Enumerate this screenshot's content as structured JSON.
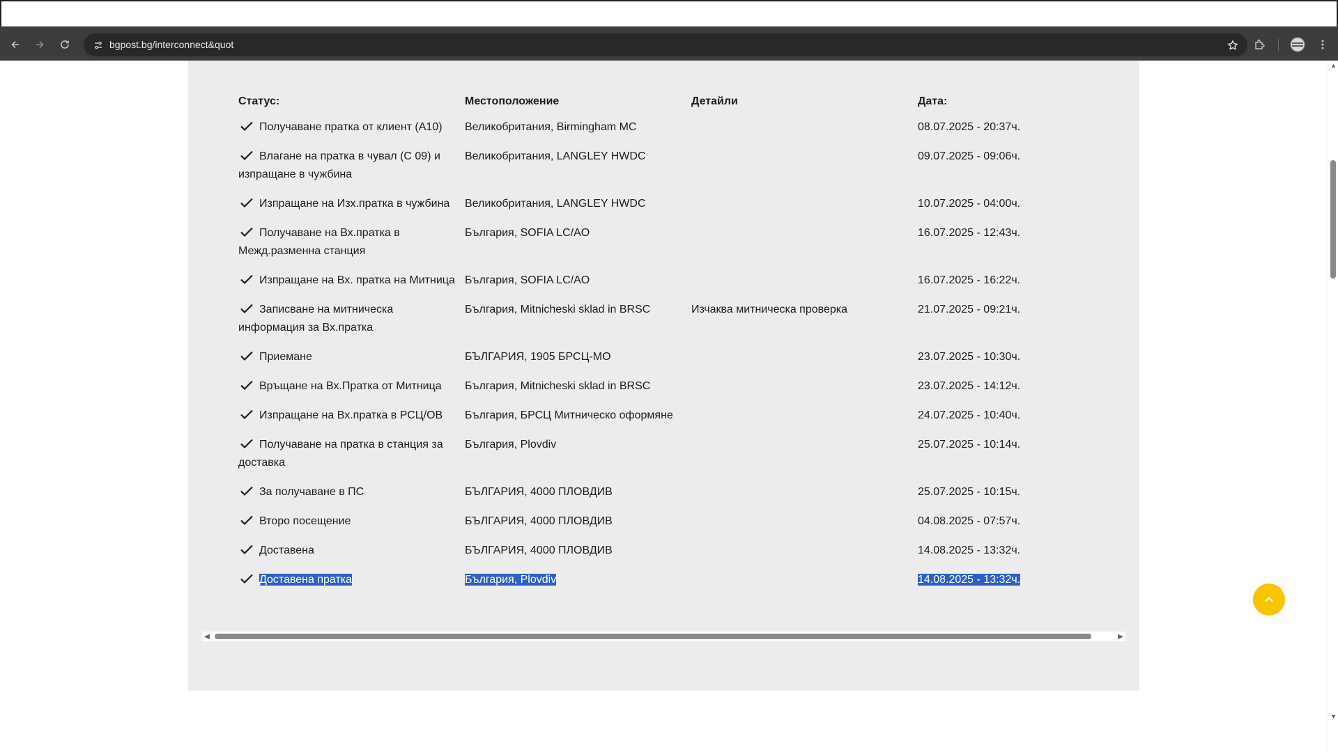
{
  "browser": {
    "url": "bgpost.bg/interconnect&quot"
  },
  "icons": {
    "back": "arrow-left-icon",
    "forward": "arrow-right-icon",
    "reload": "reload-icon",
    "site_info": "tune-icon",
    "bookmark": "star-icon",
    "extensions": "puzzle-icon",
    "profile": "avatar-icon",
    "menu": "kebab-menu-icon",
    "scroll_top": "chevron-up-icon",
    "check": "checkmark-icon"
  },
  "colors": {
    "browser_chrome": "#3c3c3c",
    "panel_background": "#ececec",
    "selection": "#2f5fc4",
    "scroll_top_button": "#f7c600"
  },
  "tracking": {
    "headers": {
      "status": "Статус:",
      "location": "Местоположение",
      "details": "Детайли",
      "date": "Дата:"
    },
    "rows": [
      {
        "status": "Получаване пратка от клиент (A10)",
        "location": "Великобритания, Birmingham MC",
        "details": "",
        "date": "08.07.2025 - 20:37ч."
      },
      {
        "status": "Влагане на пратка в чувал (C 09) и изпращане в чужбина",
        "location": "Великобритания, LANGLEY HWDC",
        "details": "",
        "date": "09.07.2025 - 09:06ч."
      },
      {
        "status": "Изпращане на Изх.пратка в чужбина",
        "location": "Великобритания, LANGLEY HWDC",
        "details": "",
        "date": "10.07.2025 - 04:00ч."
      },
      {
        "status": "Получаване на Вх.пратка в Межд.разменна станция",
        "location": "България, SOFIA LC/AO",
        "details": "",
        "date": "16.07.2025 - 12:43ч."
      },
      {
        "status": "Изпращане на Вх. пратка на Митница",
        "location": "България, SOFIA LC/AO",
        "details": "",
        "date": "16.07.2025 - 16:22ч."
      },
      {
        "status": "Записване на митническа информация за Вх.пратка",
        "location": "България, Mitnicheski sklad in BRSC",
        "details": "Изчаква митническа проверка",
        "date": "21.07.2025 - 09:21ч."
      },
      {
        "status": "Приемане",
        "location": "БЪЛГАРИЯ, 1905 БРСЦ-МО",
        "details": "",
        "date": "23.07.2025 - 10:30ч."
      },
      {
        "status": "Връщане на Вх.Пратка от Митница",
        "location": "България, Mitnicheski sklad in BRSC",
        "details": "",
        "date": "23.07.2025 - 14:12ч."
      },
      {
        "status": "Изпращане на Вх.пратка в РСЦ/ОВ",
        "location": "България, БРСЦ Митническо оформяне",
        "details": "",
        "date": "24.07.2025 - 10:40ч."
      },
      {
        "status": "Получаване на пратка в станция за доставка",
        "location": "България, Plovdiv",
        "details": "",
        "date": "25.07.2025 - 10:14ч."
      },
      {
        "status": "За получаване в ПС",
        "location": "БЪЛГАРИЯ, 4000 ПЛОВДИВ",
        "details": "",
        "date": "25.07.2025 - 10:15ч."
      },
      {
        "status": "Второ посещение",
        "location": "БЪЛГАРИЯ, 4000 ПЛОВДИВ",
        "details": "",
        "date": "04.08.2025 - 07:57ч."
      },
      {
        "status": "Доставена",
        "location": "БЪЛГАРИЯ, 4000 ПЛОВДИВ",
        "details": "",
        "date": "14.08.2025 - 13:32ч."
      },
      {
        "status": "Доставена пратка",
        "location": "България, Plovdiv",
        "details": "",
        "date": "14.08.2025 - 13:32ч.",
        "selected": true
      }
    ]
  }
}
